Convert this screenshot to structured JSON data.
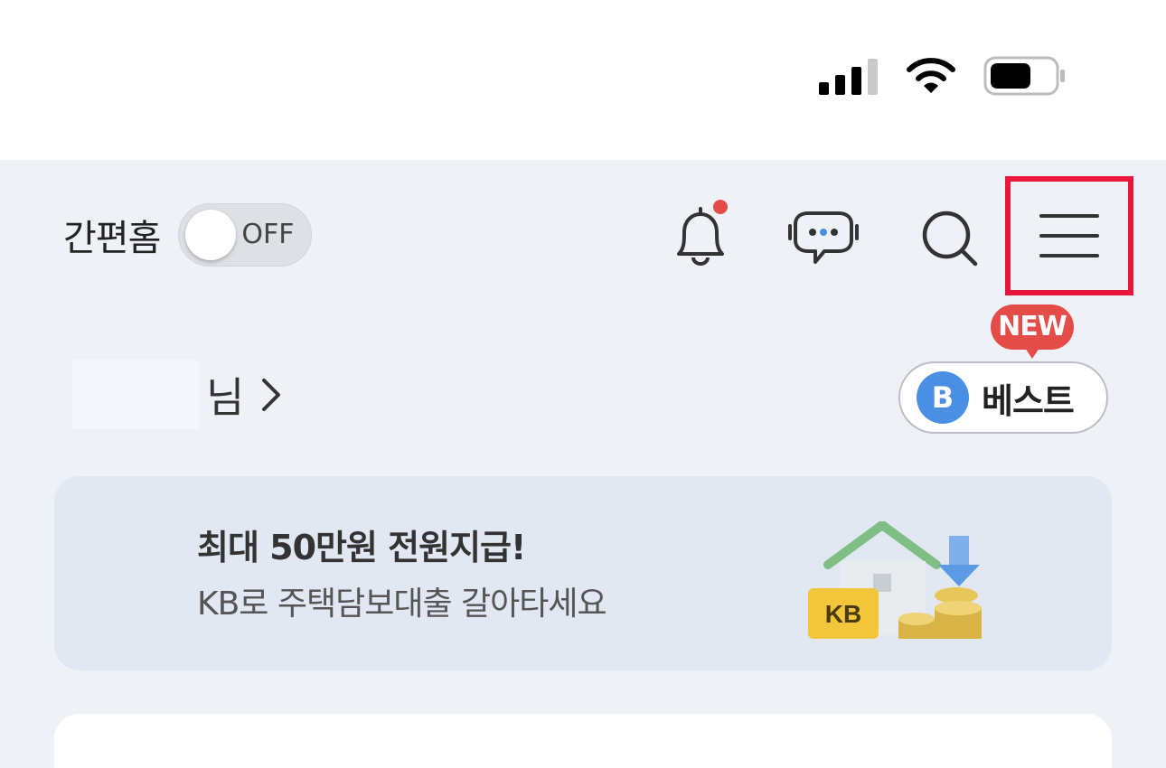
{
  "status_bar": {
    "signal_icon": "cellular-signal-icon",
    "wifi_icon": "wifi-icon",
    "battery_icon": "battery-icon"
  },
  "header": {
    "simple_home_label": "간편홈",
    "simple_home_toggle_state": "OFF",
    "icons": [
      "bell-icon",
      "chatbot-icon",
      "search-icon",
      "menu-icon"
    ],
    "highlight_color": "#e8173a"
  },
  "greeting": {
    "suffix": "님"
  },
  "best": {
    "badge": "NEW",
    "circle_letter": "B",
    "label": "베스트"
  },
  "banner": {
    "title": "최대 50만원 전원지급!",
    "subtitle": "KB로 주택담보대출 갈아타세요",
    "art_label": "KB"
  }
}
